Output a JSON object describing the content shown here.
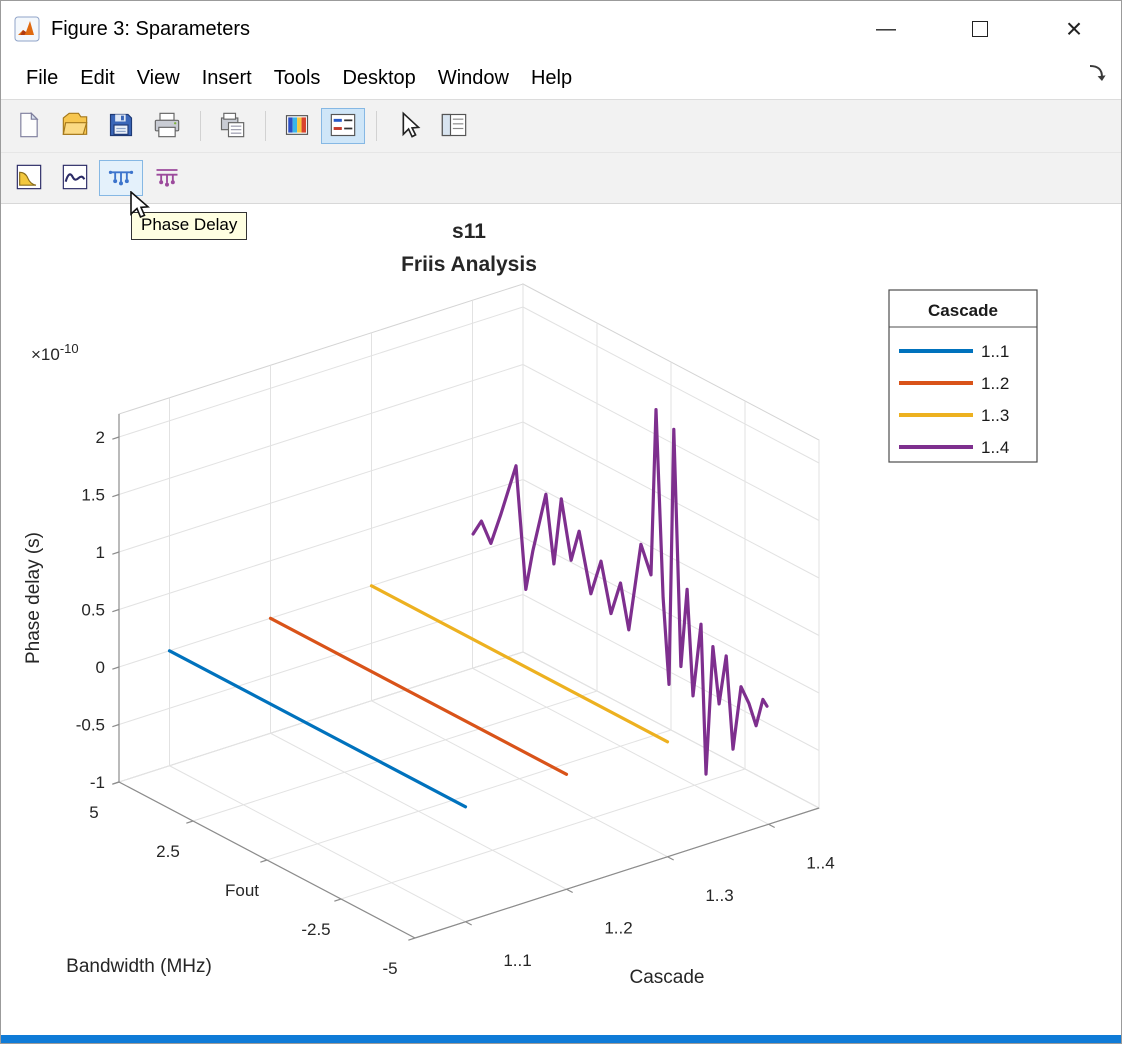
{
  "window": {
    "title": "Figure 3: Sparameters",
    "minimize_glyph": "—",
    "close_glyph": "×"
  },
  "menu": {
    "items": [
      "File",
      "Edit",
      "View",
      "Insert",
      "Tools",
      "Desktop",
      "Window",
      "Help"
    ]
  },
  "toolbars": {
    "main_icons": [
      "new-figure-icon",
      "open-file-icon",
      "save-figure-icon",
      "print-figure-icon",
      "print-preview-icon",
      "insert-colorbar-icon",
      "insert-legend-icon",
      "edit-plot-icon",
      "plot-tools-icon"
    ],
    "main_states": {
      "insert-legend-icon": "pressed"
    },
    "plot_icons": [
      "magnitude-icon",
      "angle-icon",
      "phase-delay-icon",
      "group-delay-icon"
    ],
    "plot_states": {
      "phase-delay-icon": "hover"
    }
  },
  "tooltip": {
    "text": "Phase Delay"
  },
  "colors": {
    "tooltip_bg": "#FFFFE1",
    "taskbar_edge": "#0F7BD7",
    "series": [
      "#0072BD",
      "#D95319",
      "#EDB120",
      "#7E2F8E"
    ]
  },
  "chart_data": {
    "type": "line",
    "projection": "3d",
    "title": "s11",
    "subtitle": "Friis Analysis",
    "xlabel": "Bandwidth (MHz)",
    "ylabel": "Cascade",
    "zlabel": "Phase delay (s)",
    "z_scale": {
      "base": "×10",
      "exp": "-10"
    },
    "xlim": [
      -5,
      5
    ],
    "x_direction": "5 at back, -5 at front",
    "x_ticks": [
      {
        "value": 5,
        "label": "5"
      },
      {
        "value": 2.5,
        "label": "2.5"
      },
      {
        "value": 0,
        "label": "Fout"
      },
      {
        "value": -2.5,
        "label": "-2.5"
      },
      {
        "value": -5,
        "label": "-5"
      }
    ],
    "ylim": [
      0.5,
      4.5
    ],
    "y_ticks": [
      {
        "value": 1,
        "label": "1..1"
      },
      {
        "value": 2,
        "label": "1..2"
      },
      {
        "value": 3,
        "label": "1..3"
      },
      {
        "value": 4,
        "label": "1..4"
      }
    ],
    "zlim": [
      -1,
      2.2
    ],
    "z_ticks": [
      {
        "value": -1,
        "label": "-1"
      },
      {
        "value": -0.5,
        "label": "-0.5"
      },
      {
        "value": 0,
        "label": "0"
      },
      {
        "value": 0.5,
        "label": "0.5"
      },
      {
        "value": 1,
        "label": "1"
      },
      {
        "value": 1.5,
        "label": "1.5"
      },
      {
        "value": 2,
        "label": "2"
      }
    ],
    "z_values_unit": "1e-10 s",
    "grid": true,
    "legend": {
      "title": "Cascade",
      "position": "northeast",
      "entries": [
        {
          "label": "1..1",
          "color": "#0072BD"
        },
        {
          "label": "1..2",
          "color": "#D95319"
        },
        {
          "label": "1..3",
          "color": "#EDB120"
        },
        {
          "label": "1..4",
          "color": "#7E2F8E"
        }
      ]
    },
    "series": [
      {
        "name": "1..1",
        "y": 1,
        "color": "#0072BD",
        "x": [
          5,
          -5
        ],
        "z": [
          0,
          0
        ]
      },
      {
        "name": "1..2",
        "y": 2,
        "color": "#D95319",
        "x": [
          5,
          -5
        ],
        "z": [
          0,
          0
        ]
      },
      {
        "name": "1..3",
        "y": 3,
        "color": "#EDB120",
        "x": [
          5,
          -5
        ],
        "z": [
          0,
          0
        ]
      },
      {
        "name": "1..4",
        "y": 4,
        "color": "#7E2F8E",
        "x": [
          4.98,
          4.7,
          4.38,
          4.04,
          3.53,
          3.2,
          2.96,
          2.52,
          2.25,
          2.0,
          1.67,
          1.4,
          1.0,
          0.66,
          0.32,
          0.0,
          -0.28,
          -0.69,
          -1.03,
          -1.2,
          -1.44,
          -1.64,
          -1.8,
          -2.04,
          -2.25,
          -2.45,
          -2.72,
          -2.89,
          -3.12,
          -3.33,
          -3.57,
          -3.8,
          -4.07,
          -4.34,
          -4.58,
          -4.81,
          -4.95
        ],
        "z": [
          0.17,
          0.32,
          0.17,
          0.47,
          0.96,
          -0.07,
          0.3,
          0.85,
          0.28,
          0.88,
          0.39,
          0.68,
          0.19,
          0.52,
          0.11,
          0.42,
          0.05,
          0.85,
          0.63,
          2.09,
          0.49,
          -0.24,
          2.0,
          -0.03,
          0.67,
          -0.23,
          0.43,
          -0.85,
          0.29,
          -0.18,
          0.27,
          -0.51,
          0.07,
          -0.04,
          -0.2,
          0.06,
          0.02
        ]
      }
    ]
  }
}
